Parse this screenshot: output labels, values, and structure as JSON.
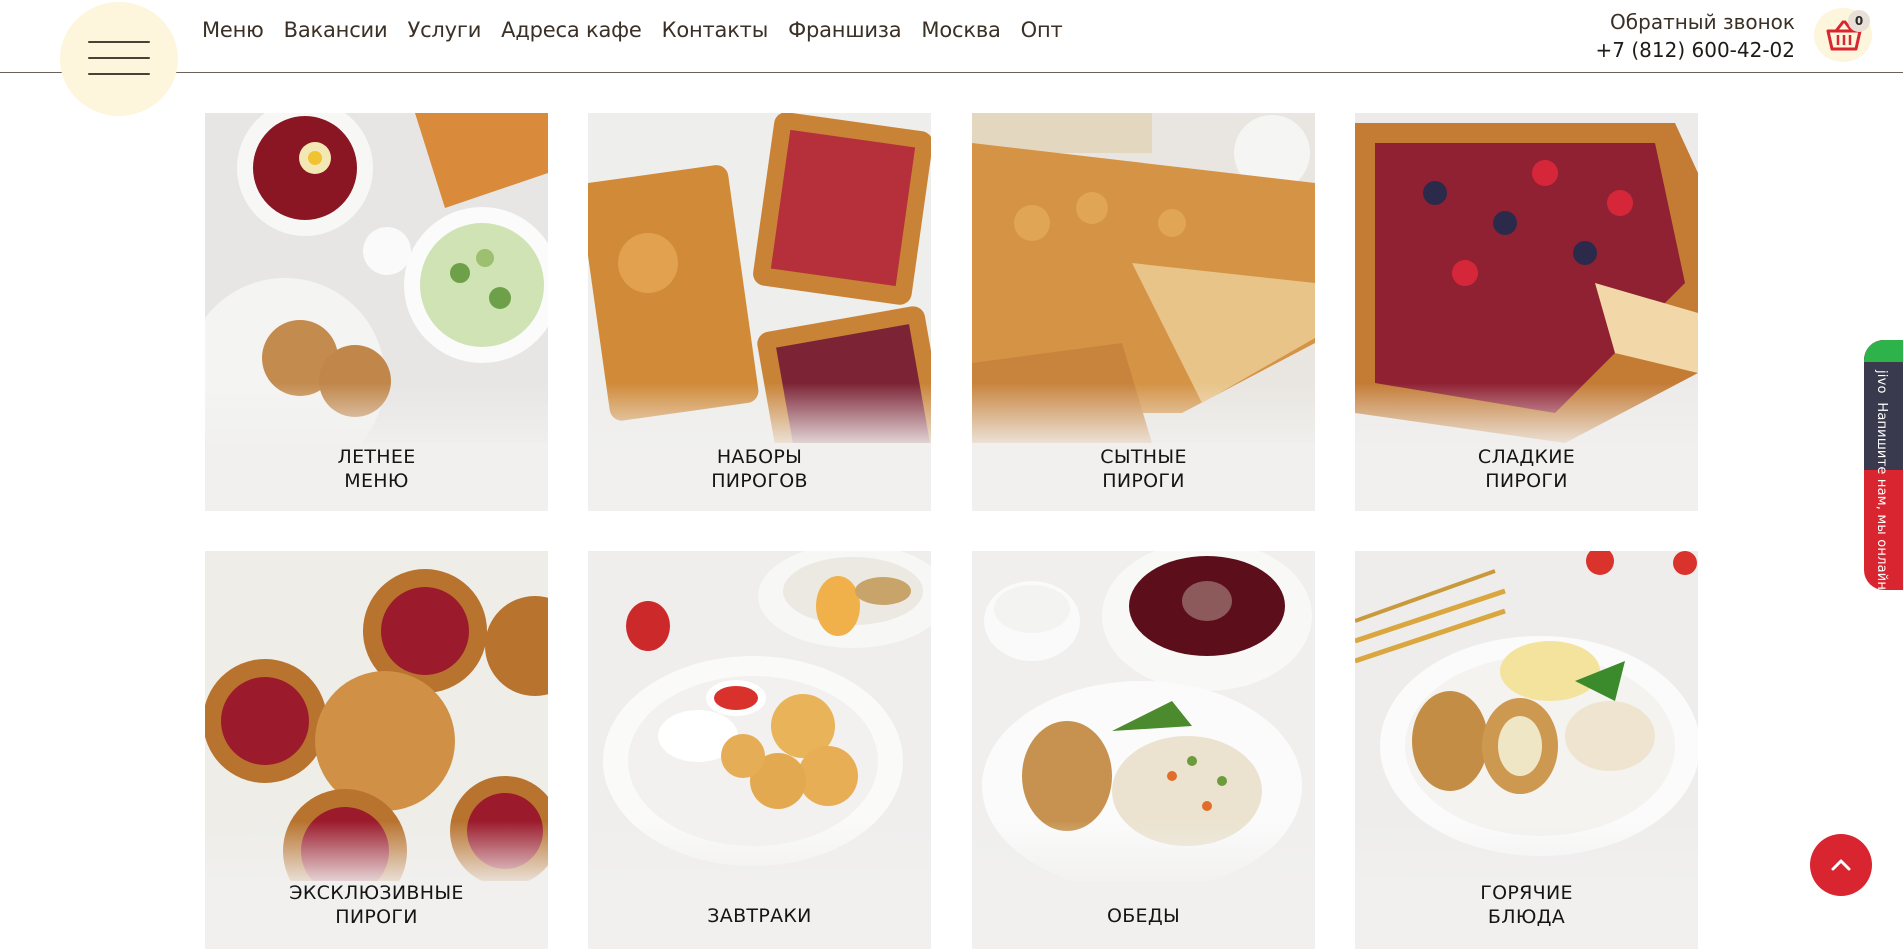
{
  "header": {
    "nav": [
      "Меню",
      "Вакансии",
      "Услуги",
      "Адреса кафе",
      "Контакты",
      "Франшиза",
      "Москва",
      "Опт"
    ],
    "callback_label": "Обратный звонок",
    "phone": "+7 (812) 600-42-02",
    "cart_count": "0"
  },
  "categories": [
    {
      "line1": "ЛЕТНЕЕ",
      "line2": "МЕНЮ"
    },
    {
      "line1": "НАБОРЫ",
      "line2": "ПИРОГОВ"
    },
    {
      "line1": "СЫТНЫЕ",
      "line2": "ПИРОГИ"
    },
    {
      "line1": "СЛАДКИЕ",
      "line2": "ПИРОГИ"
    },
    {
      "line1": "ЭКСКЛЮЗИВНЫЕ",
      "line2": "ПИРОГИ"
    },
    {
      "line1": "ЗАВТРАКИ",
      "line2": ""
    },
    {
      "line1": "ОБЕДЫ",
      "line2": ""
    },
    {
      "line1": "ГОРЯЧИЕ",
      "line2": "БЛЮДА"
    }
  ],
  "jivo": {
    "text": "Напишите нам, мы онлайн!",
    "brand": "jivo"
  },
  "icons": {
    "menu": "hamburger-menu-icon",
    "cart": "shopping-basket-icon",
    "scroll_up": "chevron-up-icon"
  },
  "colors": {
    "accent": "#d9252f",
    "cream": "#fdf5dc",
    "card_bg": "#f1f0ef"
  }
}
